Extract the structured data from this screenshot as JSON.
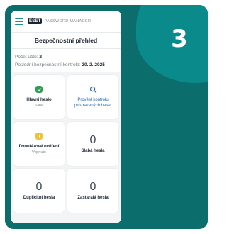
{
  "step": {
    "number": "3"
  },
  "app": {
    "logo": "ESET",
    "product": "PASSWORD MANAGER",
    "title": "Bezpečnostní přehled"
  },
  "info": {
    "accounts_label": "Počet účtů:",
    "accounts_value": "2",
    "last_check_label": "Poslední bezpečnostní kontrola:",
    "last_check_value": "20. 2. 2025"
  },
  "cards": {
    "master": {
      "title": "Hlavní heslo",
      "status": "Silné",
      "icon": "check-icon"
    },
    "check": {
      "label": "Provést kontrolu prozrazených hesel",
      "icon": "search-icon"
    },
    "twofa": {
      "title": "Dvoufázové ověření",
      "status": "Vypnuto",
      "icon": "warning-icon"
    },
    "weak": {
      "count": "0",
      "label": "Slabá hesla"
    },
    "duplicate": {
      "count": "0",
      "label": "Duplicitní hesla"
    },
    "old": {
      "count": "0",
      "label": "Zastaralá hesla"
    }
  },
  "colors": {
    "background": "#0c6e6c",
    "accent": "#0b8a8c",
    "ok": "#2f9e52",
    "warning": "#f2c230",
    "link": "#2a63b8"
  }
}
